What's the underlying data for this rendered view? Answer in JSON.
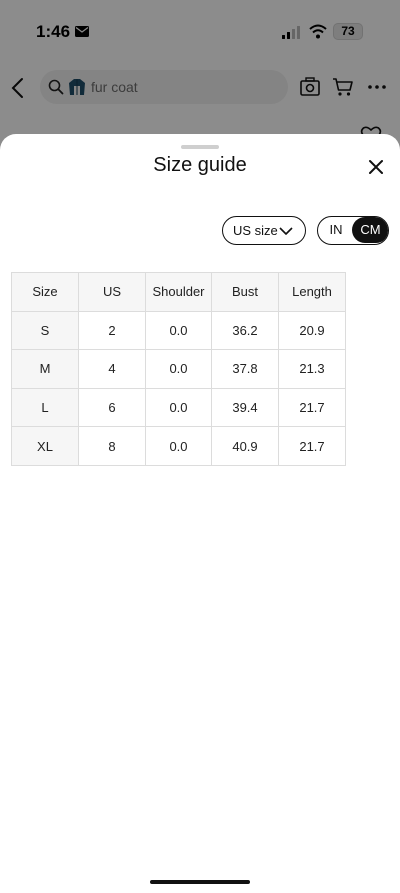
{
  "status_bar": {
    "time": "1:46",
    "battery": "73"
  },
  "search": {
    "query": "fur coat"
  },
  "sheet": {
    "title": "Size guide",
    "size_selector": "US size",
    "units": {
      "in": "IN",
      "cm": "CM",
      "selected": "CM"
    }
  },
  "table": {
    "headers": [
      "Size",
      "US",
      "Shoulder",
      "Bust",
      "Length"
    ],
    "rows": [
      [
        "S",
        "2",
        "0.0",
        "36.2",
        "20.9"
      ],
      [
        "M",
        "4",
        "0.0",
        "37.8",
        "21.3"
      ],
      [
        "L",
        "6",
        "0.0",
        "39.4",
        "21.7"
      ],
      [
        "XL",
        "8",
        "0.0",
        "40.9",
        "21.7"
      ]
    ]
  },
  "icons": {
    "back": "back-icon",
    "search": "search-icon",
    "coat_thumbnail": "coat-icon",
    "camera": "camera-icon",
    "cart": "cart-icon",
    "more": "more-icon",
    "heart": "heart-icon",
    "close": "close-icon",
    "chevron": "chevron-down-icon"
  },
  "colors": {
    "accent": "#111111",
    "overlay": "rgba(0,0,0,0.45)",
    "table_header_bg": "#f6f6f6",
    "table_border": "#dcdcdc"
  }
}
